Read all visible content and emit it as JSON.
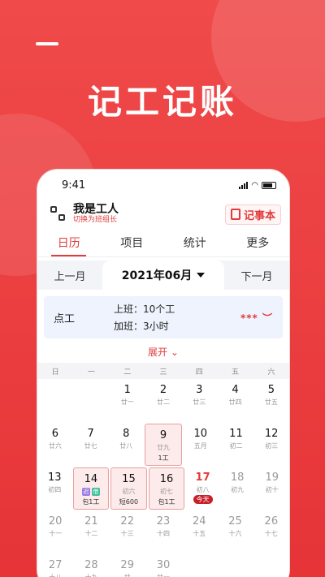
{
  "hero": {
    "title": "记工记账"
  },
  "status_bar": {
    "time": "9:41"
  },
  "user": {
    "name": "我是工人",
    "switch_label": "切换为班组长",
    "notebook_label": "记事本"
  },
  "tabs": [
    "日历",
    "项目",
    "统计",
    "更多"
  ],
  "month_nav": {
    "prev": "上一月",
    "current": "2021年06月",
    "next": "下一月"
  },
  "summary": {
    "label": "点工",
    "work": "上班：10个工",
    "overtime": "加班：3小时",
    "eye": "***"
  },
  "expand_label": "展开",
  "weekdays": [
    "日",
    "一",
    "二",
    "三",
    "四",
    "五",
    "六"
  ],
  "weeks": [
    [
      {
        "d": "",
        "l": ""
      },
      {
        "d": "",
        "l": ""
      },
      {
        "d": "1",
        "l": "廿一"
      },
      {
        "d": "2",
        "l": "廿二"
      },
      {
        "d": "3",
        "l": "廿三"
      },
      {
        "d": "4",
        "l": "廿四"
      },
      {
        "d": "5",
        "l": "廿五"
      }
    ],
    [
      {
        "d": "6",
        "l": "廿六"
      },
      {
        "d": "7",
        "l": "廿七"
      },
      {
        "d": "8",
        "l": "廿八"
      },
      {
        "d": "9",
        "l": "廿九",
        "e": "1工",
        "mark": true
      },
      {
        "d": "10",
        "l": "五月"
      },
      {
        "d": "11",
        "l": "初二"
      },
      {
        "d": "12",
        "l": "初三"
      }
    ],
    [
      {
        "d": "13",
        "l": "初四"
      },
      {
        "d": "14",
        "l": "",
        "e": "包1工",
        "mark": true,
        "tags": [
          "迟",
          "借"
        ]
      },
      {
        "d": "15",
        "l": "初六",
        "e": "短600",
        "mark": true
      },
      {
        "d": "16",
        "l": "初七",
        "e": "包1工",
        "mark": true
      },
      {
        "d": "17",
        "l": "初八",
        "today": true,
        "badge": "今天"
      },
      {
        "d": "18",
        "l": "初九",
        "muted": true
      },
      {
        "d": "19",
        "l": "初十",
        "muted": true
      }
    ],
    [
      {
        "d": "20",
        "l": "十一",
        "muted": true
      },
      {
        "d": "21",
        "l": "十二",
        "muted": true
      },
      {
        "d": "22",
        "l": "十三",
        "muted": true
      },
      {
        "d": "23",
        "l": "十四",
        "muted": true
      },
      {
        "d": "24",
        "l": "十五",
        "muted": true
      },
      {
        "d": "25",
        "l": "十六",
        "muted": true
      },
      {
        "d": "26",
        "l": "十七",
        "muted": true
      }
    ],
    [
      {
        "d": "27",
        "l": "十八",
        "muted": true
      },
      {
        "d": "28",
        "l": "十九",
        "muted": true
      },
      {
        "d": "29",
        "l": "廿",
        "muted": true
      },
      {
        "d": "30",
        "l": "廿一",
        "muted": true
      },
      {
        "d": "",
        "l": ""
      },
      {
        "d": "",
        "l": ""
      },
      {
        "d": "",
        "l": ""
      }
    ]
  ],
  "colors": {
    "accent": "#e23b3b",
    "background": "#e8383b"
  }
}
